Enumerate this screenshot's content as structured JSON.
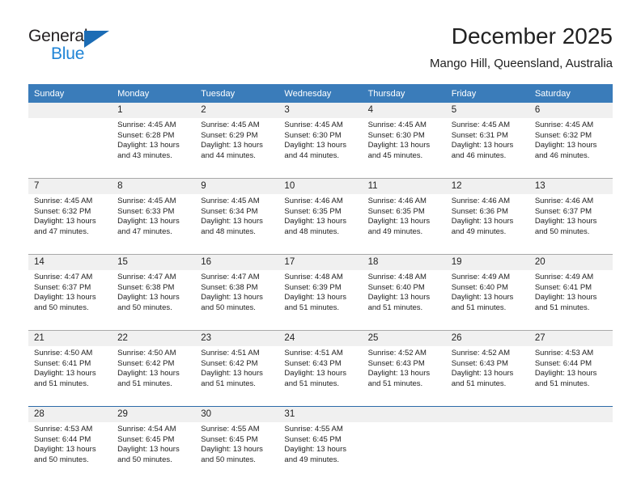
{
  "brand": {
    "name_part1": "General",
    "name_part2": "Blue",
    "triangle_color": "#1b6cb5",
    "blue_color": "#1f84d6"
  },
  "header": {
    "month_title": "December 2025",
    "location": "Mango Hill, Queensland, Australia"
  },
  "colors": {
    "header_row_background": "#3a7cba",
    "daynum_background": "#f0f0f0",
    "separator": "#a9a9a9",
    "blue_separator": "#2d6aa8",
    "text": "#222222"
  },
  "weekdays": [
    "Sunday",
    "Monday",
    "Tuesday",
    "Wednesday",
    "Thursday",
    "Friday",
    "Saturday"
  ],
  "weeks": [
    {
      "separator": "none",
      "days": [
        {
          "day": "",
          "lines": []
        },
        {
          "day": "1",
          "lines": [
            "Sunrise: 4:45 AM",
            "Sunset: 6:28 PM",
            "Daylight: 13 hours",
            "and 43 minutes."
          ]
        },
        {
          "day": "2",
          "lines": [
            "Sunrise: 4:45 AM",
            "Sunset: 6:29 PM",
            "Daylight: 13 hours",
            "and 44 minutes."
          ]
        },
        {
          "day": "3",
          "lines": [
            "Sunrise: 4:45 AM",
            "Sunset: 6:30 PM",
            "Daylight: 13 hours",
            "and 44 minutes."
          ]
        },
        {
          "day": "4",
          "lines": [
            "Sunrise: 4:45 AM",
            "Sunset: 6:30 PM",
            "Daylight: 13 hours",
            "and 45 minutes."
          ]
        },
        {
          "day": "5",
          "lines": [
            "Sunrise: 4:45 AM",
            "Sunset: 6:31 PM",
            "Daylight: 13 hours",
            "and 46 minutes."
          ]
        },
        {
          "day": "6",
          "lines": [
            "Sunrise: 4:45 AM",
            "Sunset: 6:32 PM",
            "Daylight: 13 hours",
            "and 46 minutes."
          ]
        }
      ]
    },
    {
      "separator": "gray",
      "days": [
        {
          "day": "7",
          "lines": [
            "Sunrise: 4:45 AM",
            "Sunset: 6:32 PM",
            "Daylight: 13 hours",
            "and 47 minutes."
          ]
        },
        {
          "day": "8",
          "lines": [
            "Sunrise: 4:45 AM",
            "Sunset: 6:33 PM",
            "Daylight: 13 hours",
            "and 47 minutes."
          ]
        },
        {
          "day": "9",
          "lines": [
            "Sunrise: 4:45 AM",
            "Sunset: 6:34 PM",
            "Daylight: 13 hours",
            "and 48 minutes."
          ]
        },
        {
          "day": "10",
          "lines": [
            "Sunrise: 4:46 AM",
            "Sunset: 6:35 PM",
            "Daylight: 13 hours",
            "and 48 minutes."
          ]
        },
        {
          "day": "11",
          "lines": [
            "Sunrise: 4:46 AM",
            "Sunset: 6:35 PM",
            "Daylight: 13 hours",
            "and 49 minutes."
          ]
        },
        {
          "day": "12",
          "lines": [
            "Sunrise: 4:46 AM",
            "Sunset: 6:36 PM",
            "Daylight: 13 hours",
            "and 49 minutes."
          ]
        },
        {
          "day": "13",
          "lines": [
            "Sunrise: 4:46 AM",
            "Sunset: 6:37 PM",
            "Daylight: 13 hours",
            "and 50 minutes."
          ]
        }
      ]
    },
    {
      "separator": "gray",
      "days": [
        {
          "day": "14",
          "lines": [
            "Sunrise: 4:47 AM",
            "Sunset: 6:37 PM",
            "Daylight: 13 hours",
            "and 50 minutes."
          ]
        },
        {
          "day": "15",
          "lines": [
            "Sunrise: 4:47 AM",
            "Sunset: 6:38 PM",
            "Daylight: 13 hours",
            "and 50 minutes."
          ]
        },
        {
          "day": "16",
          "lines": [
            "Sunrise: 4:47 AM",
            "Sunset: 6:38 PM",
            "Daylight: 13 hours",
            "and 50 minutes."
          ]
        },
        {
          "day": "17",
          "lines": [
            "Sunrise: 4:48 AM",
            "Sunset: 6:39 PM",
            "Daylight: 13 hours",
            "and 51 minutes."
          ]
        },
        {
          "day": "18",
          "lines": [
            "Sunrise: 4:48 AM",
            "Sunset: 6:40 PM",
            "Daylight: 13 hours",
            "and 51 minutes."
          ]
        },
        {
          "day": "19",
          "lines": [
            "Sunrise: 4:49 AM",
            "Sunset: 6:40 PM",
            "Daylight: 13 hours",
            "and 51 minutes."
          ]
        },
        {
          "day": "20",
          "lines": [
            "Sunrise: 4:49 AM",
            "Sunset: 6:41 PM",
            "Daylight: 13 hours",
            "and 51 minutes."
          ]
        }
      ]
    },
    {
      "separator": "gray",
      "days": [
        {
          "day": "21",
          "lines": [
            "Sunrise: 4:50 AM",
            "Sunset: 6:41 PM",
            "Daylight: 13 hours",
            "and 51 minutes."
          ]
        },
        {
          "day": "22",
          "lines": [
            "Sunrise: 4:50 AM",
            "Sunset: 6:42 PM",
            "Daylight: 13 hours",
            "and 51 minutes."
          ]
        },
        {
          "day": "23",
          "lines": [
            "Sunrise: 4:51 AM",
            "Sunset: 6:42 PM",
            "Daylight: 13 hours",
            "and 51 minutes."
          ]
        },
        {
          "day": "24",
          "lines": [
            "Sunrise: 4:51 AM",
            "Sunset: 6:43 PM",
            "Daylight: 13 hours",
            "and 51 minutes."
          ]
        },
        {
          "day": "25",
          "lines": [
            "Sunrise: 4:52 AM",
            "Sunset: 6:43 PM",
            "Daylight: 13 hours",
            "and 51 minutes."
          ]
        },
        {
          "day": "26",
          "lines": [
            "Sunrise: 4:52 AM",
            "Sunset: 6:43 PM",
            "Daylight: 13 hours",
            "and 51 minutes."
          ]
        },
        {
          "day": "27",
          "lines": [
            "Sunrise: 4:53 AM",
            "Sunset: 6:44 PM",
            "Daylight: 13 hours",
            "and 51 minutes."
          ]
        }
      ]
    },
    {
      "separator": "blue",
      "days": [
        {
          "day": "28",
          "lines": [
            "Sunrise: 4:53 AM",
            "Sunset: 6:44 PM",
            "Daylight: 13 hours",
            "and 50 minutes."
          ]
        },
        {
          "day": "29",
          "lines": [
            "Sunrise: 4:54 AM",
            "Sunset: 6:45 PM",
            "Daylight: 13 hours",
            "and 50 minutes."
          ]
        },
        {
          "day": "30",
          "lines": [
            "Sunrise: 4:55 AM",
            "Sunset: 6:45 PM",
            "Daylight: 13 hours",
            "and 50 minutes."
          ]
        },
        {
          "day": "31",
          "lines": [
            "Sunrise: 4:55 AM",
            "Sunset: 6:45 PM",
            "Daylight: 13 hours",
            "and 49 minutes."
          ]
        },
        {
          "day": "",
          "lines": []
        },
        {
          "day": "",
          "lines": []
        },
        {
          "day": "",
          "lines": []
        }
      ]
    }
  ]
}
